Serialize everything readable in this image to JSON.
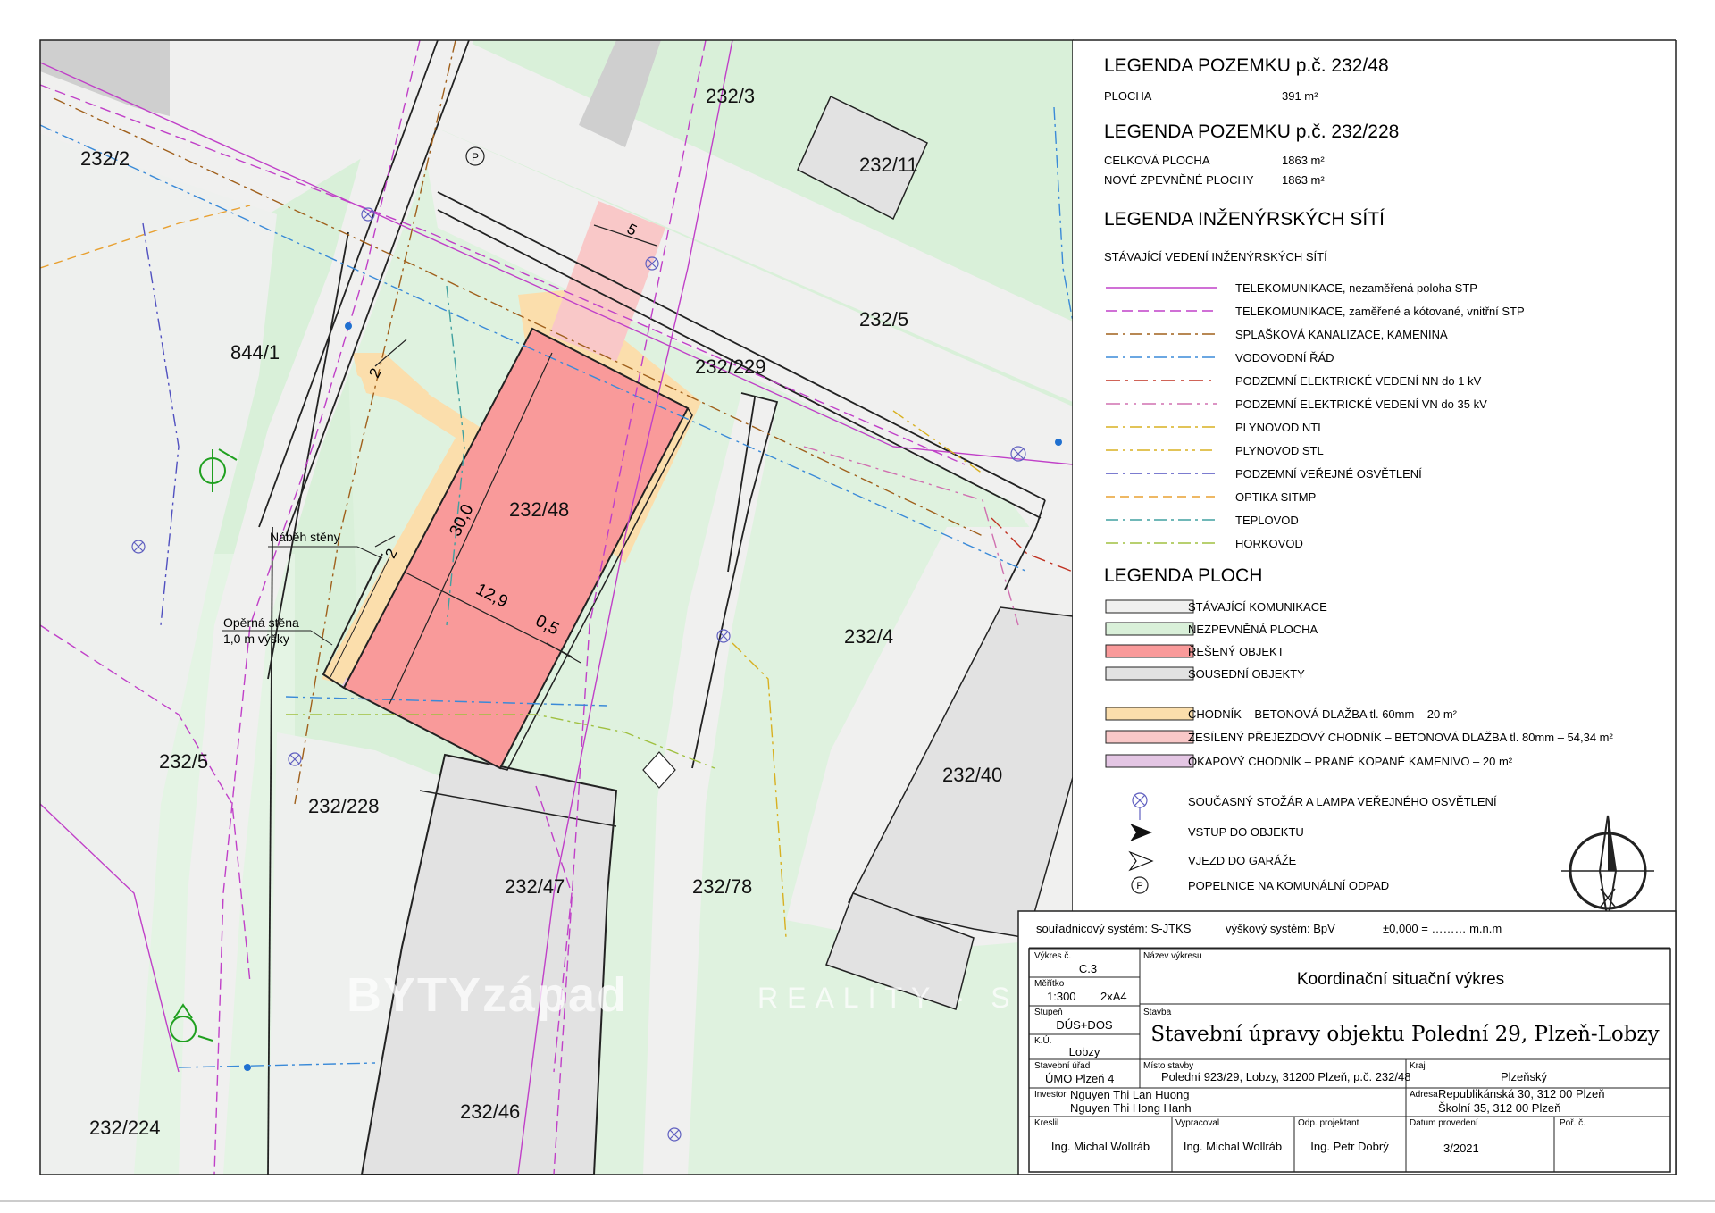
{
  "parcels": {
    "p232_3": "232/3",
    "p232_11": "232/11",
    "p232_2": "232/2",
    "p232_5_top": "232/5",
    "p844_1": "844/1",
    "p232_229": "232/229",
    "p232_48": "232/48",
    "p232_4": "232/4",
    "p232_40": "232/40",
    "p232_5_left": "232/5",
    "p232_228": "232/228",
    "p232_47": "232/47",
    "p232_78": "232/78",
    "p232_46": "232/46",
    "p232_224": "232/224"
  },
  "dimensions": {
    "length": "30,0",
    "width": "12,9",
    "offset": "0,5",
    "setback_top": "2",
    "setback_side": "2",
    "driveway": "5"
  },
  "annotations": {
    "wall_slope": "Náběh stěny",
    "retaining_wall_1": "Opěrná stěna",
    "retaining_wall_2": "1,0 m výšky",
    "bin_symbol": "P"
  },
  "legend_plot": {
    "title": "LEGENDA POZEMKU p.č. 232/48",
    "area_label": "PLOCHA",
    "area_value": "391 m²"
  },
  "legend_plot2": {
    "title": "LEGENDA POZEMKU p.č. 232/228",
    "total_label": "CELKOVÁ PLOCHA",
    "total_value": "1863 m²",
    "paved_label": "NOVÉ ZPEVNĚNÉ PLOCHY",
    "paved_value": "1863 m²"
  },
  "legend_networks": {
    "title": "LEGENDA INŽENÝRSKÝCH SÍTÍ",
    "subtitle": "STÁVAJÍCÍ VEDENÍ INŽENÝRSKÝCH SÍTÍ",
    "items": [
      {
        "label": "TELEKOMUNIKACE, nezaměřená poloha STP",
        "color": "#c040c8",
        "dash": ""
      },
      {
        "label": "TELEKOMUNIKACE, zaměřené a kótované, vnitřní STP",
        "color": "#c040c8",
        "dash": "12 6"
      },
      {
        "label": "SPLAŠKOVÁ KANALIZACE, KAMENINA",
        "color": "#a0601c",
        "dash": "14 5 3 5"
      },
      {
        "label": "VODOVODNÍ ŘÁD",
        "color": "#3a8ad8",
        "dash": "14 5 3 5"
      },
      {
        "label": "PODZEMNÍ ELEKTRICKÉ VEDENÍ NN do 1 kV",
        "color": "#c03020",
        "dash": "16 6 3 6"
      },
      {
        "label": "PODZEMNÍ ELEKTRICKÉ VEDENÍ VN do 35 kV",
        "color": "#d070b0",
        "dash": "16 6 3 6 3 6"
      },
      {
        "label": "PLYNOVOD NTL",
        "color": "#d8b020",
        "dash": "14 5 3 5"
      },
      {
        "label": "PLYNOVOD STL",
        "color": "#d8b020",
        "dash": "14 5 3 5 3 5"
      },
      {
        "label": "PODZEMNÍ VEŘEJNÉ OSVĚTLENÍ",
        "color": "#5050c0",
        "dash": "14 5 3 5"
      },
      {
        "label": "OPTIKA SITMP",
        "color": "#e8a030",
        "dash": "10 6"
      },
      {
        "label": "TEPLOVOD",
        "color": "#40a0a0",
        "dash": "14 5 3 5"
      },
      {
        "label": "HORKOVOD",
        "color": "#a0c040",
        "dash": "14 5 3 5"
      }
    ]
  },
  "legend_areas": {
    "title": "LEGENDA PLOCH",
    "items": [
      {
        "label": "STÁVAJÍCÍ KOMUNIKACE",
        "color": "#f0f0ef"
      },
      {
        "label": "NEZPEVNĚNÁ PLOCHA",
        "color": "#d9f0d9"
      },
      {
        "label": "ŘEŠENÝ OBJEKT",
        "color": "#f99a9a"
      },
      {
        "label": "SOUSEDNÍ OBJEKTY",
        "color": "#e2e2e2"
      },
      {
        "label": "CHODNÍK – BETONOVÁ DLAŽBA tl. 60mm – 20 m²",
        "color": "#fbdeac"
      },
      {
        "label": "ZESÍLENÝ PŘEJEZDOVÝ CHODNÍK – BETONOVÁ DLAŽBA tl. 80mm – 54,34 m²",
        "color": "#f9c8c8"
      },
      {
        "label": "OKAPOVÝ CHODNÍK – PRANÉ KOPANÉ KAMENIVO – 20 m²",
        "color": "#e4c6e4"
      }
    ],
    "symbols": [
      {
        "label": "SOUČASNÝ STOŽÁR A LAMPA VEŘEJNÉHO OSVĚTLENÍ",
        "icon": "lamp-icon"
      },
      {
        "label": "VSTUP DO OBJEKTU",
        "icon": "entry-arrow-icon"
      },
      {
        "label": "VJEZD DO GARÁŽE",
        "icon": "garage-arrow-icon"
      },
      {
        "label": "POPELNICE NA KOMUNÁLNÍ ODPAD",
        "icon": "bin-icon"
      }
    ],
    "bin_letter": "P"
  },
  "title_block": {
    "coord_system": "souřadnicový systém: S-JTKS",
    "height_system": "výškový systém: BpV",
    "zero_level": "±0,000 = ……… m.n.m",
    "drawing_no_label": "Výkres č.",
    "drawing_no": "C.3",
    "drawing_name_label": "Název výkresu",
    "drawing_name": "Koordinační situační výkres",
    "scale_label": "Měřítko",
    "scale": "1:300",
    "format": "2xA4",
    "stage_label": "Stupeň",
    "stage": "DÚS+DOS",
    "ku_label": "K.Ú.",
    "ku": "Lobzy",
    "building_label": "Stavba",
    "building": "Stavební úpravy objektu Polední 29, Plzeň-Lobzy",
    "office_label": "Stavební úřad",
    "office": "ÚMO Plzeň 4",
    "place_label": "Místo stavby",
    "place": "Polední 923/29, Lobzy, 31200 Plzeň, p.č. 232/48",
    "region_label": "Kraj",
    "region": "Plzeňský",
    "investor_label": "Investor",
    "investor_1": "Nguyen Thi Lan Huong",
    "investor_2": "Nguyen Thi Hong Hanh",
    "address_label": "Adresa",
    "address_1": "Republikánská 30, 312 00 Plzeň",
    "address_2": "Školní 35, 312 00 Plzeň",
    "drew_label": "Kreslil",
    "drew": "Ing. Michal Wollráb",
    "prepared_label": "Vypracoval",
    "prepared": "Ing. Michal Wollráb",
    "resp_label": "Odp. projektant",
    "resp": "Ing. Petr Dobrý",
    "date_label": "Datum provedení",
    "date": "3/2021",
    "seq_label": "Poř. č."
  },
  "watermark": {
    "brand": "BYTYzápad",
    "text": "REALITY · S"
  },
  "colors": {
    "road": "#f0f0ef",
    "green": "#d9f0d9",
    "building": "#f99a9a",
    "neighbor": "#e2e2e2",
    "sidewalk": "#fbdeac",
    "driveway": "#f9c8c8",
    "eaves": "#e4c6e4"
  }
}
